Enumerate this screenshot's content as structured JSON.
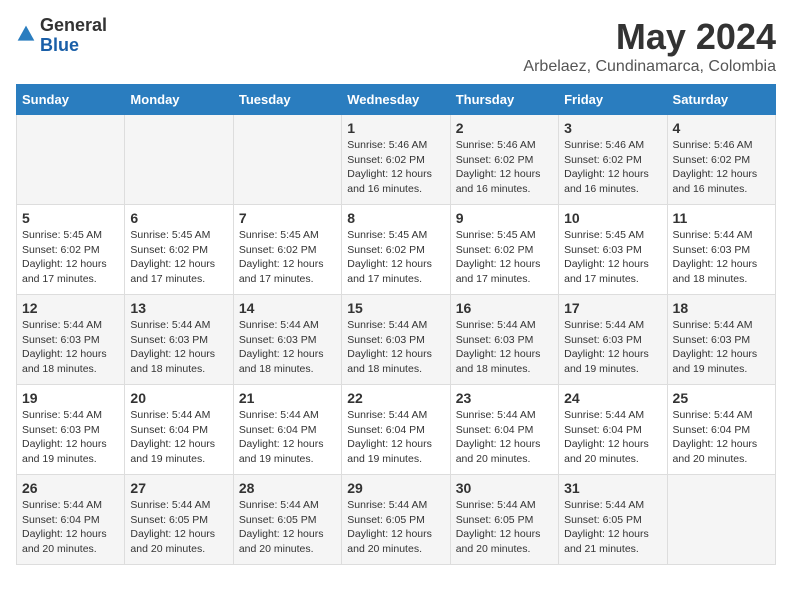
{
  "logo": {
    "general": "General",
    "blue": "Blue"
  },
  "title": "May 2024",
  "subtitle": "Arbelaez, Cundinamarca, Colombia",
  "headers": [
    "Sunday",
    "Monday",
    "Tuesday",
    "Wednesday",
    "Thursday",
    "Friday",
    "Saturday"
  ],
  "weeks": [
    [
      {
        "day": "",
        "info": ""
      },
      {
        "day": "",
        "info": ""
      },
      {
        "day": "",
        "info": ""
      },
      {
        "day": "1",
        "info": "Sunrise: 5:46 AM\nSunset: 6:02 PM\nDaylight: 12 hours\nand 16 minutes."
      },
      {
        "day": "2",
        "info": "Sunrise: 5:46 AM\nSunset: 6:02 PM\nDaylight: 12 hours\nand 16 minutes."
      },
      {
        "day": "3",
        "info": "Sunrise: 5:46 AM\nSunset: 6:02 PM\nDaylight: 12 hours\nand 16 minutes."
      },
      {
        "day": "4",
        "info": "Sunrise: 5:46 AM\nSunset: 6:02 PM\nDaylight: 12 hours\nand 16 minutes."
      }
    ],
    [
      {
        "day": "5",
        "info": "Sunrise: 5:45 AM\nSunset: 6:02 PM\nDaylight: 12 hours\nand 17 minutes."
      },
      {
        "day": "6",
        "info": "Sunrise: 5:45 AM\nSunset: 6:02 PM\nDaylight: 12 hours\nand 17 minutes."
      },
      {
        "day": "7",
        "info": "Sunrise: 5:45 AM\nSunset: 6:02 PM\nDaylight: 12 hours\nand 17 minutes."
      },
      {
        "day": "8",
        "info": "Sunrise: 5:45 AM\nSunset: 6:02 PM\nDaylight: 12 hours\nand 17 minutes."
      },
      {
        "day": "9",
        "info": "Sunrise: 5:45 AM\nSunset: 6:02 PM\nDaylight: 12 hours\nand 17 minutes."
      },
      {
        "day": "10",
        "info": "Sunrise: 5:45 AM\nSunset: 6:03 PM\nDaylight: 12 hours\nand 17 minutes."
      },
      {
        "day": "11",
        "info": "Sunrise: 5:44 AM\nSunset: 6:03 PM\nDaylight: 12 hours\nand 18 minutes."
      }
    ],
    [
      {
        "day": "12",
        "info": "Sunrise: 5:44 AM\nSunset: 6:03 PM\nDaylight: 12 hours\nand 18 minutes."
      },
      {
        "day": "13",
        "info": "Sunrise: 5:44 AM\nSunset: 6:03 PM\nDaylight: 12 hours\nand 18 minutes."
      },
      {
        "day": "14",
        "info": "Sunrise: 5:44 AM\nSunset: 6:03 PM\nDaylight: 12 hours\nand 18 minutes."
      },
      {
        "day": "15",
        "info": "Sunrise: 5:44 AM\nSunset: 6:03 PM\nDaylight: 12 hours\nand 18 minutes."
      },
      {
        "day": "16",
        "info": "Sunrise: 5:44 AM\nSunset: 6:03 PM\nDaylight: 12 hours\nand 18 minutes."
      },
      {
        "day": "17",
        "info": "Sunrise: 5:44 AM\nSunset: 6:03 PM\nDaylight: 12 hours\nand 19 minutes."
      },
      {
        "day": "18",
        "info": "Sunrise: 5:44 AM\nSunset: 6:03 PM\nDaylight: 12 hours\nand 19 minutes."
      }
    ],
    [
      {
        "day": "19",
        "info": "Sunrise: 5:44 AM\nSunset: 6:03 PM\nDaylight: 12 hours\nand 19 minutes."
      },
      {
        "day": "20",
        "info": "Sunrise: 5:44 AM\nSunset: 6:04 PM\nDaylight: 12 hours\nand 19 minutes."
      },
      {
        "day": "21",
        "info": "Sunrise: 5:44 AM\nSunset: 6:04 PM\nDaylight: 12 hours\nand 19 minutes."
      },
      {
        "day": "22",
        "info": "Sunrise: 5:44 AM\nSunset: 6:04 PM\nDaylight: 12 hours\nand 19 minutes."
      },
      {
        "day": "23",
        "info": "Sunrise: 5:44 AM\nSunset: 6:04 PM\nDaylight: 12 hours\nand 20 minutes."
      },
      {
        "day": "24",
        "info": "Sunrise: 5:44 AM\nSunset: 6:04 PM\nDaylight: 12 hours\nand 20 minutes."
      },
      {
        "day": "25",
        "info": "Sunrise: 5:44 AM\nSunset: 6:04 PM\nDaylight: 12 hours\nand 20 minutes."
      }
    ],
    [
      {
        "day": "26",
        "info": "Sunrise: 5:44 AM\nSunset: 6:04 PM\nDaylight: 12 hours\nand 20 minutes."
      },
      {
        "day": "27",
        "info": "Sunrise: 5:44 AM\nSunset: 6:05 PM\nDaylight: 12 hours\nand 20 minutes."
      },
      {
        "day": "28",
        "info": "Sunrise: 5:44 AM\nSunset: 6:05 PM\nDaylight: 12 hours\nand 20 minutes."
      },
      {
        "day": "29",
        "info": "Sunrise: 5:44 AM\nSunset: 6:05 PM\nDaylight: 12 hours\nand 20 minutes."
      },
      {
        "day": "30",
        "info": "Sunrise: 5:44 AM\nSunset: 6:05 PM\nDaylight: 12 hours\nand 20 minutes."
      },
      {
        "day": "31",
        "info": "Sunrise: 5:44 AM\nSunset: 6:05 PM\nDaylight: 12 hours\nand 21 minutes."
      },
      {
        "day": "",
        "info": ""
      }
    ]
  ]
}
